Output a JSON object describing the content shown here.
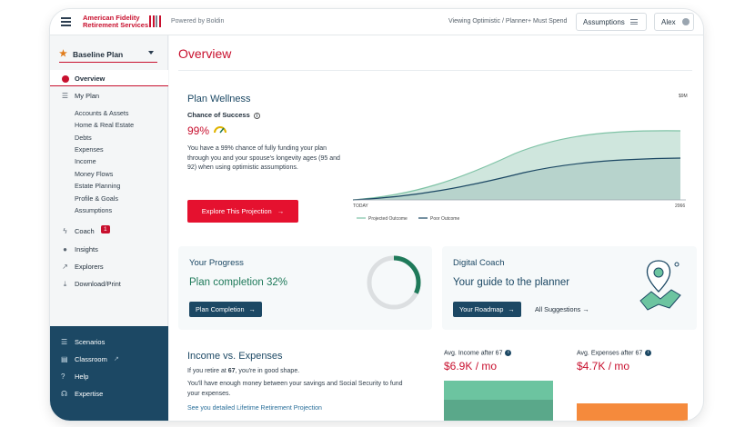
{
  "topbar": {
    "logo_line1": "American Fidelity",
    "logo_line2": "Retirement Services",
    "powered": "Powered by Boldin",
    "viewing": "Viewing Optimistic / Planner+ Must Spend",
    "assumptions": "Assumptions",
    "user": "Alex"
  },
  "sidebar": {
    "plan_selector": "Baseline Plan",
    "overview": "Overview",
    "my_plan": "My Plan",
    "sub_items": [
      "Accounts & Assets",
      "Home & Real Estate",
      "Debts",
      "Expenses",
      "Income",
      "Money Flows",
      "Estate Planning",
      "Profile & Goals",
      "Assumptions"
    ],
    "coach": "Coach",
    "coach_badge": "1",
    "insights": "Insights",
    "explorers": "Explorers",
    "download": "Download/Print",
    "bottom": [
      "Scenarios",
      "Classroom",
      "Help",
      "Expertise"
    ]
  },
  "main": {
    "title": "Overview",
    "wellness_title": "Plan Wellness",
    "chance_label": "Chance of Success",
    "chance_value": "99%",
    "chance_text": "You have a 99% chance of fully funding your plan through you and your spouse's longevity ages (95 and 92) when using optimistic assumptions.",
    "explore_button": "Explore This Projection",
    "chart": {
      "y_label": "$9M",
      "x_start": "TODAY",
      "x_end": "2066",
      "legend_projected": "Projected Outcome",
      "legend_poor": "Poor Outcome"
    },
    "progress": {
      "title": "Your Progress",
      "completion": "Plan completion 32%",
      "button": "Plan Completion",
      "percent": 32
    },
    "coach": {
      "title": "Digital Coach",
      "tagline": "Your guide to the planner",
      "roadmap_button": "Your Roadmap",
      "suggestions_link": "All Suggestions"
    },
    "income": {
      "title": "Income vs. Expenses",
      "line1_pre": "If you retire at ",
      "line1_age": "67",
      "line1_post": ", you're in good shape.",
      "line2": "You'll have enough money between your savings and Social Security to fund your expenses.",
      "link": "See you detailed Lifetime Retirement Projection",
      "avg_income_label": "Avg. Income after 67",
      "avg_income_value": "$6.9K / mo",
      "avg_expenses_label": "Avg. Expenses after 67",
      "avg_expenses_value": "$4.7K / mo"
    }
  },
  "colors": {
    "brand_red": "#c8102e",
    "navy": "#1c4864",
    "green": "#1f7a5a",
    "income_bar": "#6cc4a0",
    "expense_bar": "#f58a3c"
  }
}
